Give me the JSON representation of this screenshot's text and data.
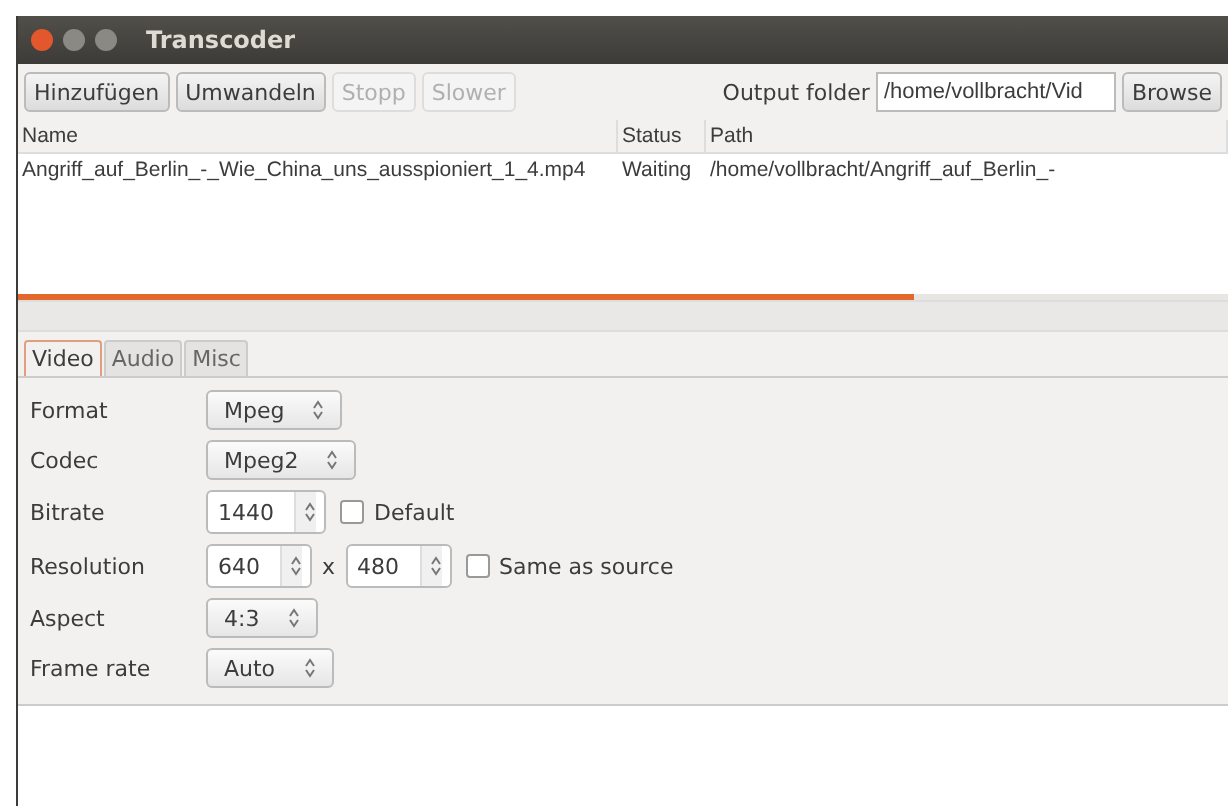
{
  "window": {
    "title": "Transcoder"
  },
  "toolbar": {
    "buttons": [
      {
        "label": "Hinzufügen",
        "disabled": false
      },
      {
        "label": "Umwandeln",
        "disabled": false
      },
      {
        "label": "Stopp",
        "disabled": true
      },
      {
        "label": "Slower",
        "disabled": true
      }
    ],
    "output_label": "Output folder",
    "output_value": "/home/vollbracht/Vid",
    "browse": "Browse"
  },
  "table": {
    "columns": [
      "Name",
      "Status",
      "Path"
    ],
    "rows": [
      [
        "Angriff_auf_Berlin_-_Wie_China_uns_ausspioniert_1_4.mp4",
        "Waiting",
        "/home/vollbracht/Angriff_auf_Berlin_-"
      ]
    ]
  },
  "progress": {
    "level": 0.74
  },
  "tabs": [
    {
      "label": "Video",
      "selected": true
    },
    {
      "label": "Audio",
      "selected": false
    },
    {
      "label": "Misc",
      "selected": false
    }
  ],
  "settings": [
    {
      "label": "Format",
      "kind": "combo",
      "value": "Mpeg"
    },
    {
      "label": "Codec",
      "kind": "combo",
      "value": "Mpeg2"
    },
    {
      "label": "Bitrate",
      "kind": "spins",
      "fields": [
        "1440"
      ],
      "check": {
        "label": "Default",
        "checked": false
      }
    },
    {
      "label": "Resolution",
      "kind": "spins",
      "fields": [
        "640",
        "480"
      ],
      "separator": "x",
      "check": {
        "label": "Same as source",
        "checked": false
      }
    },
    {
      "label": "Aspect",
      "kind": "combo",
      "value": "4:3"
    },
    {
      "label": "Frame rate",
      "kind": "combo",
      "value": "Auto"
    }
  ]
}
